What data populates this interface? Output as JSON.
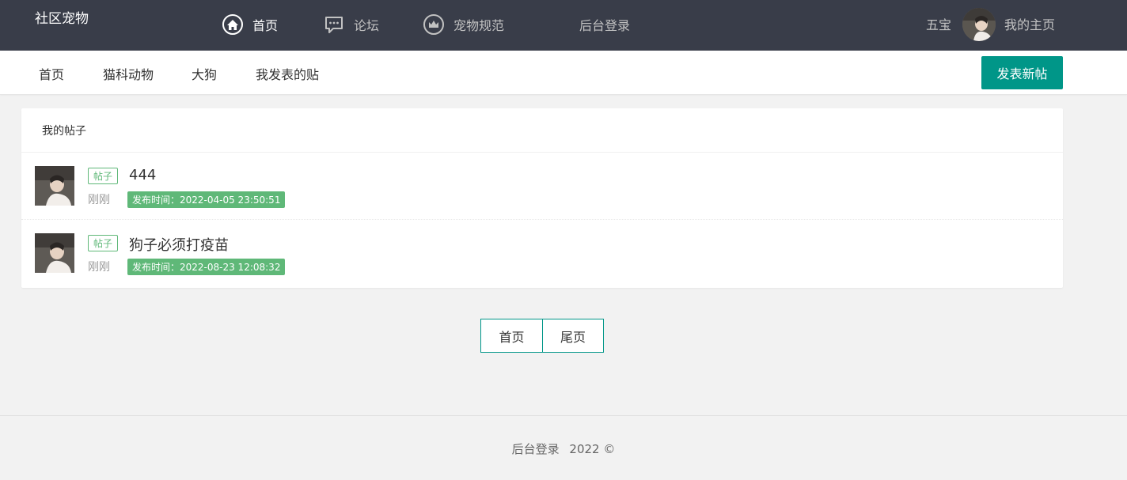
{
  "header": {
    "logo": "社区宠物",
    "nav": [
      {
        "label": "首页",
        "icon": "home-icon",
        "active": true
      },
      {
        "label": "论坛",
        "icon": "chat-icon",
        "active": false
      },
      {
        "label": "宠物规范",
        "icon": "crown-icon",
        "active": false
      },
      {
        "label": "后台登录",
        "icon": "",
        "active": false
      }
    ],
    "user_name": "五宝",
    "my_home": "我的主页"
  },
  "subnav": {
    "items": [
      "首页",
      "猫科动物",
      "大狗",
      "我发表的贴"
    ],
    "post_button": "发表新帖"
  },
  "card": {
    "title": "我的帖子",
    "posts": [
      {
        "tag": "帖子",
        "title": "444",
        "ago": "刚刚",
        "time": "发布时间：2022-04-05 23:50:51"
      },
      {
        "tag": "帖子",
        "title": "狗子必须打疫苗",
        "ago": "刚刚",
        "time": "发布时间：2022-08-23 12:08:32"
      }
    ]
  },
  "pager": {
    "first": "首页",
    "last": "尾页"
  },
  "footer": {
    "link": "后台登录",
    "year": "2022 ©"
  },
  "colors": {
    "header_bg": "#393d49",
    "accent": "#009688",
    "tag_green": "#5fb878"
  }
}
